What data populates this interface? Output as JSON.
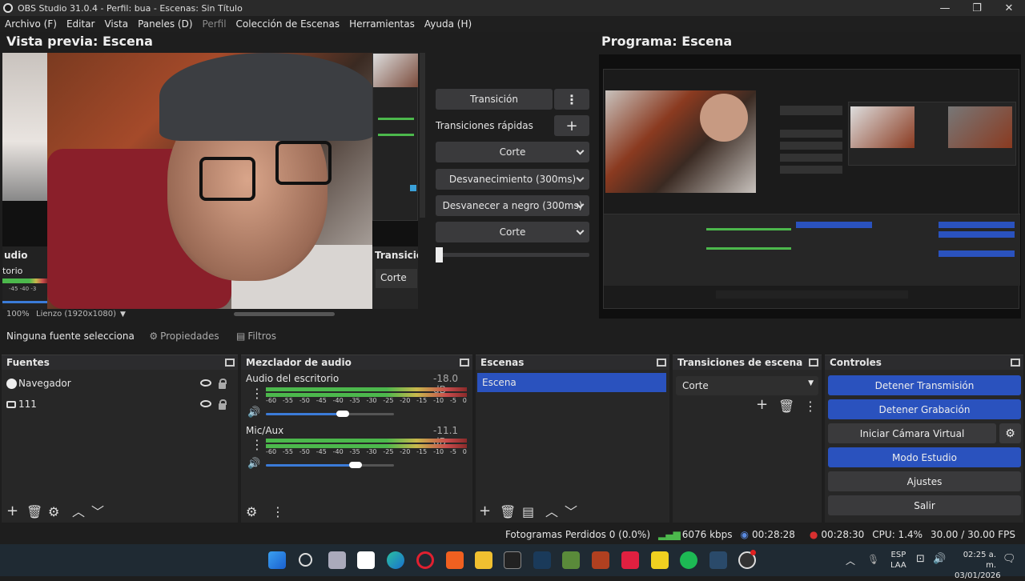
{
  "window": {
    "title": "OBS Studio 31.0.4 - Perfil: bua - Escenas: Sin Título",
    "min": "—",
    "max": "❐",
    "close": "✕"
  },
  "menu": {
    "archivo": "Archivo (F)",
    "editar": "Editar",
    "vista": "Vista",
    "paneles": "Paneles (D)",
    "perfil": "Perfil",
    "coleccion": "Colección de Escenas",
    "herramientas": "Herramientas",
    "ayuda": "Ayuda (H)"
  },
  "preview": {
    "title": "Vista previa: Escena",
    "zoom": "100%",
    "canvas": "Lienzo (1920x1080)",
    "overlay_audio": "udio",
    "overlay_torio": "torio",
    "overlay_transicion": "Transicion",
    "overlay_corte": "Corte",
    "overlay_ticks": "-45  -40  -3"
  },
  "transitions_mid": {
    "transicion_btn": "Transición",
    "rapidas_label": "Transiciones rápidas",
    "corte1": "Corte",
    "desvanecimiento": "Desvanecimiento (300ms)",
    "negro": "Desvanecer a negro (300ms)",
    "corte2": "Corte"
  },
  "program": {
    "title": "Programa: Escena"
  },
  "source_toolbar": {
    "no_source": "Ninguna fuente selecciona",
    "propiedades": "Propiedades",
    "filtros": "Filtros"
  },
  "fuentes": {
    "title": "Fuentes",
    "items": [
      {
        "label": "Navegador"
      },
      {
        "label": "111"
      }
    ]
  },
  "mezclador": {
    "title": "Mezclador de audio",
    "channels": [
      {
        "name": "Audio del escritorio",
        "db": "-18.0 dB",
        "level": 0.18,
        "volume": 0.6
      },
      {
        "name": "Mic/Aux",
        "db": "-11.1 dB",
        "level": 0.25,
        "volume": 0.7
      }
    ],
    "ticks": [
      "-60",
      "-55",
      "-50",
      "-45",
      "-40",
      "-35",
      "-30",
      "-25",
      "-20",
      "-15",
      "-10",
      "-5",
      "0"
    ]
  },
  "escenas": {
    "title": "Escenas",
    "items": [
      {
        "label": "Escena"
      }
    ]
  },
  "transiciones": {
    "title": "Transiciones de escena",
    "selected": "Corte"
  },
  "controles": {
    "title": "Controles",
    "detener_transmision": "Detener Transmisión",
    "detener_grabacion": "Detener Grabación",
    "camara_virtual": "Iniciar Cámara Virtual",
    "modo_estudio": "Modo Estudio",
    "ajustes": "Ajustes",
    "salir": "Salir"
  },
  "status": {
    "frames": "Fotogramas Perdidos 0 (0.0%)",
    "kbps": "6076 kbps",
    "stream_time": "00:28:28",
    "rec_time": "00:28:30",
    "cpu": "CPU: 1.4%",
    "fps": "30.00 / 30.00 FPS"
  },
  "taskbar": {
    "lang1": "ESP",
    "lang2": "LAA",
    "time": "02:25 a. m.",
    "date": "03/01/2026"
  }
}
